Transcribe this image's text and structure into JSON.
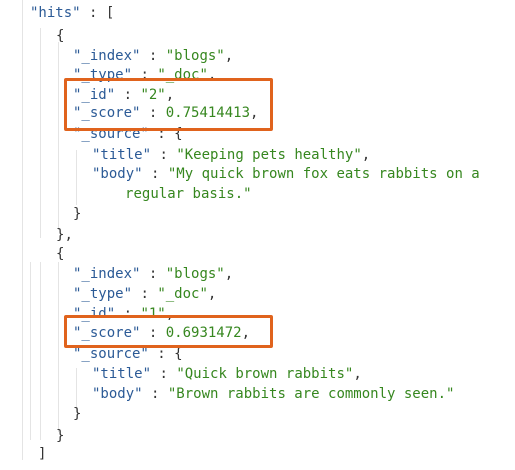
{
  "colors": {
    "key": "#2b5a96",
    "string": "#36871f",
    "punct": "#333333",
    "highlight": "#e0631d",
    "guide": "#e4e4e4",
    "background": "#ffffff"
  },
  "lines": [
    {
      "id": "hits-open",
      "text": "\"hits\" : ["
    },
    {
      "id": "hit1-open",
      "text": "{"
    },
    {
      "id": "hit1-index",
      "text": "\"_index\" : \"blogs\","
    },
    {
      "id": "hit1-type",
      "text": "\"_type\" : \"_doc\","
    },
    {
      "id": "hit1-id",
      "text": "\"_id\" : \"2\","
    },
    {
      "id": "hit1-score",
      "text": "\"_score\" : 0.75414413,"
    },
    {
      "id": "hit1-source-open",
      "text": "\"_source\" : {"
    },
    {
      "id": "hit1-title",
      "text": "\"title\" : \"Keeping pets healthy\","
    },
    {
      "id": "hit1-body",
      "text": "\"body\" : \"My quick brown fox eats rabbits on a"
    },
    {
      "id": "hit1-body-wrap",
      "text": "regular basis.\""
    },
    {
      "id": "hit1-source-close",
      "text": "}"
    },
    {
      "id": "hit1-close",
      "text": "},"
    },
    {
      "id": "hit2-open",
      "text": "{"
    },
    {
      "id": "hit2-index",
      "text": "\"_index\" : \"blogs\","
    },
    {
      "id": "hit2-type",
      "text": "\"_type\" : \"_doc\","
    },
    {
      "id": "hit2-id",
      "text": "\"_id\" : \"1\","
    },
    {
      "id": "hit2-score",
      "text": "\"_score\" : 0.6931472,"
    },
    {
      "id": "hit2-source-open",
      "text": "\"_source\" : {"
    },
    {
      "id": "hit2-title",
      "text": "\"title\" : \"Quick brown rabbits\","
    },
    {
      "id": "hit2-body",
      "text": "\"body\" : \"Brown rabbits are commonly seen.\""
    },
    {
      "id": "hit2-source-close",
      "text": "}"
    },
    {
      "id": "hit2-close",
      "text": "}"
    },
    {
      "id": "hits-close",
      "text": "]"
    }
  ],
  "highlights": [
    {
      "id": "hit1-id-score-box"
    },
    {
      "id": "hit2-score-box"
    }
  ]
}
